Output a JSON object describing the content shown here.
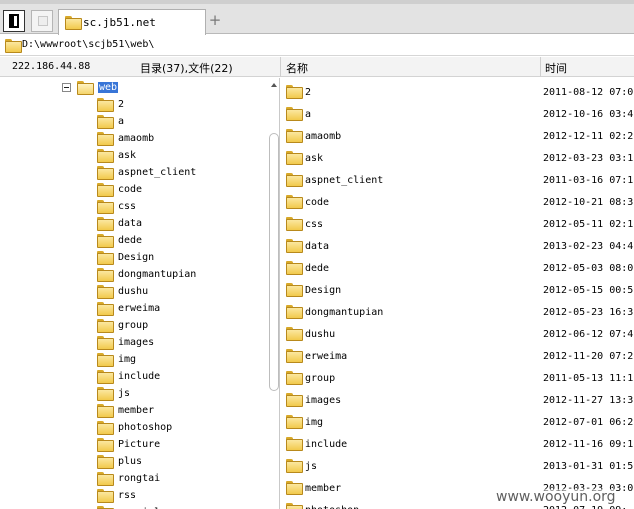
{
  "tab": {
    "title": "sc.jb51.net",
    "add_label": "+"
  },
  "path": "D:\\wwwroot\\scjb51\\web\\",
  "header": {
    "host_ip": "222.186.44.88",
    "dir_count": "目录(37),文件(22)",
    "col_name": "名称",
    "col_time": "时间"
  },
  "tree": {
    "root": "web",
    "items": [
      "2",
      "a",
      "amaomb",
      "ask",
      "aspnet_client",
      "code",
      "css",
      "data",
      "dede",
      "Design",
      "dongmantupian",
      "dushu",
      "erweima",
      "group",
      "images",
      "img",
      "include",
      "js",
      "member",
      "photoshop",
      "Picture",
      "plus",
      "rongtai",
      "rss",
      "special"
    ]
  },
  "files": [
    {
      "name": "2",
      "time": "2011-08-12 07:0"
    },
    {
      "name": "a",
      "time": "2012-10-16 03:4"
    },
    {
      "name": "amaomb",
      "time": "2012-12-11 02:2"
    },
    {
      "name": "ask",
      "time": "2012-03-23 03:1"
    },
    {
      "name": "aspnet_client",
      "time": "2011-03-16 07:1"
    },
    {
      "name": "code",
      "time": "2012-10-21 08:3"
    },
    {
      "name": "css",
      "time": "2012-05-11 02:1"
    },
    {
      "name": "data",
      "time": "2013-02-23 04:4"
    },
    {
      "name": "dede",
      "time": "2012-05-03 08:0"
    },
    {
      "name": "Design",
      "time": "2012-05-15 00:5"
    },
    {
      "name": "dongmantupian",
      "time": "2012-05-23 16:3"
    },
    {
      "name": "dushu",
      "time": "2012-06-12 07:4"
    },
    {
      "name": "erweima",
      "time": "2012-11-20 07:2"
    },
    {
      "name": "group",
      "time": "2011-05-13 11:1"
    },
    {
      "name": "images",
      "time": "2012-11-27 13:3"
    },
    {
      "name": "img",
      "time": "2012-07-01 06:2"
    },
    {
      "name": "include",
      "time": "2012-11-16 09:1"
    },
    {
      "name": "js",
      "time": "2013-01-31 01:5"
    },
    {
      "name": "member",
      "time": "2012-03-23 03:0"
    },
    {
      "name": "photoshop",
      "time": "2012-07-19 09:"
    }
  ],
  "watermark": "www.wooyun.org"
}
